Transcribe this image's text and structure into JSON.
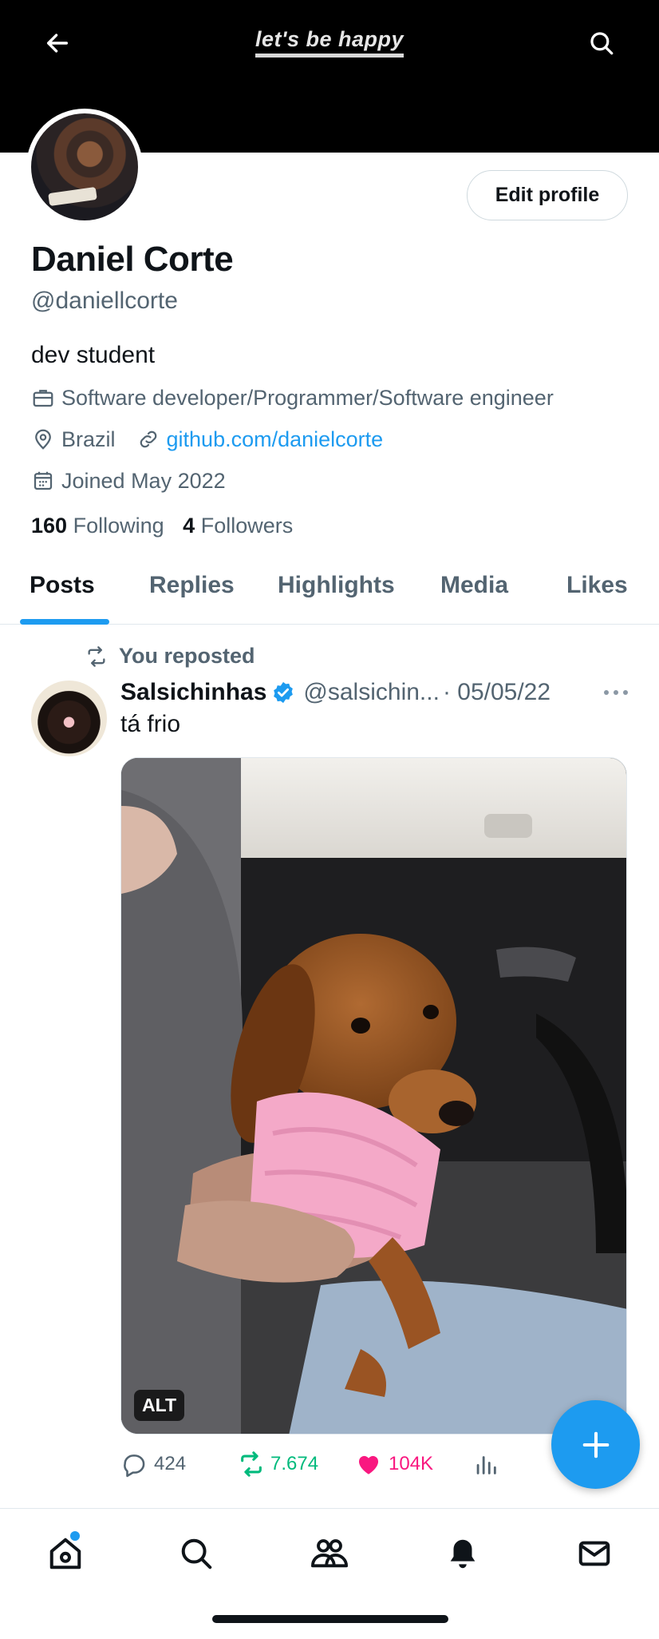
{
  "header": {
    "banner_title": "let's be happy",
    "back_icon": "arrow-left-icon",
    "search_icon": "search-icon"
  },
  "profile": {
    "name": "Daniel Corte",
    "handle": "@daniellcorte",
    "bio": "dev student",
    "profession": "Software developer/Programmer/Software engineer",
    "location": "Brazil",
    "website": "github.com/danielcorte",
    "joined": "Joined May 2022",
    "following_count": "160",
    "following_label": "Following",
    "followers_count": "4",
    "followers_label": "Followers",
    "edit_label": "Edit profile"
  },
  "tabs": [
    {
      "label": "Posts",
      "active": true
    },
    {
      "label": "Replies"
    },
    {
      "label": "Highlights"
    },
    {
      "label": "Media"
    },
    {
      "label": "Likes"
    }
  ],
  "post": {
    "repost_label": "You reposted",
    "author_name": "Salsichinhas",
    "author_handle": "@salsichin...",
    "date": "· 05/05/22",
    "text": "tá frio",
    "alt_label": "ALT",
    "replies": "424",
    "reposts": "7.674",
    "likes": "104K",
    "colors": {
      "repost": "#00ba7c",
      "like": "#f91880"
    }
  },
  "nav": [
    "home-icon",
    "search-icon",
    "communities-icon",
    "notifications-icon",
    "messages-icon"
  ],
  "colors": {
    "accent": "#1d9bf0",
    "text": "#0f1419",
    "secondary": "#536471"
  }
}
